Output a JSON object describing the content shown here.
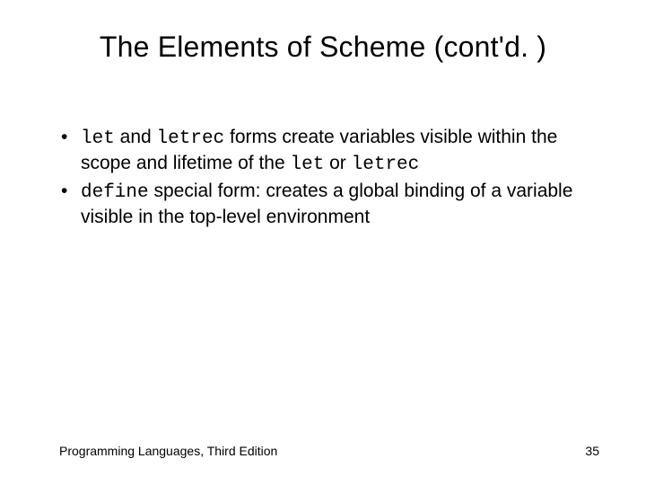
{
  "title": "The Elements of Scheme (cont'd. )",
  "bullets": [
    {
      "parts": [
        {
          "kind": "code",
          "text": "let"
        },
        {
          "kind": "text",
          "text": " and "
        },
        {
          "kind": "code",
          "text": "letrec"
        },
        {
          "kind": "text",
          "text": " forms create variables visible within the scope and lifetime of the "
        },
        {
          "kind": "code",
          "text": "let"
        },
        {
          "kind": "text",
          "text": " or "
        },
        {
          "kind": "code",
          "text": "letrec"
        }
      ]
    },
    {
      "parts": [
        {
          "kind": "code",
          "text": "define"
        },
        {
          "kind": "text",
          "text": " special form: creates a global binding of a variable visible in the top-level environment"
        }
      ]
    }
  ],
  "footer": {
    "left": "Programming Languages, Third Edition",
    "page": "35"
  }
}
